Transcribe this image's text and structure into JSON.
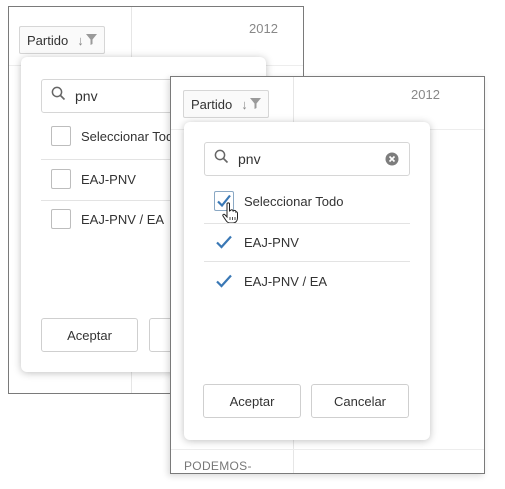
{
  "back_panel": {
    "column_header": "Partido",
    "year": "2012",
    "search_value": "pnv",
    "items": [
      {
        "label": "Seleccionar Todo",
        "checked": false
      },
      {
        "label": "EAJ-PNV",
        "checked": false
      },
      {
        "label": "EAJ-PNV / EA",
        "checked": false
      }
    ],
    "accept_label": "Aceptar"
  },
  "front_panel": {
    "column_header": "Partido",
    "year": "2012",
    "search_value": "pnv",
    "items": [
      {
        "label": "Seleccionar Todo",
        "checked": true
      },
      {
        "label": "EAJ-PNV",
        "checked": true
      },
      {
        "label": "EAJ-PNV / EA",
        "checked": true
      }
    ],
    "accept_label": "Aceptar",
    "cancel_label": "Cancelar",
    "row_below": "PODEMOS-"
  },
  "icons": {
    "sort": "sort-down-arrow-icon",
    "filter": "funnel-icon",
    "search": "search-icon",
    "clear": "clear-circle-icon",
    "check": "checkmark-icon",
    "cursor": "hand-pointer-icon"
  },
  "colors": {
    "accent": "#3a78b5",
    "border": "#d6d6d6",
    "text": "#333333"
  }
}
